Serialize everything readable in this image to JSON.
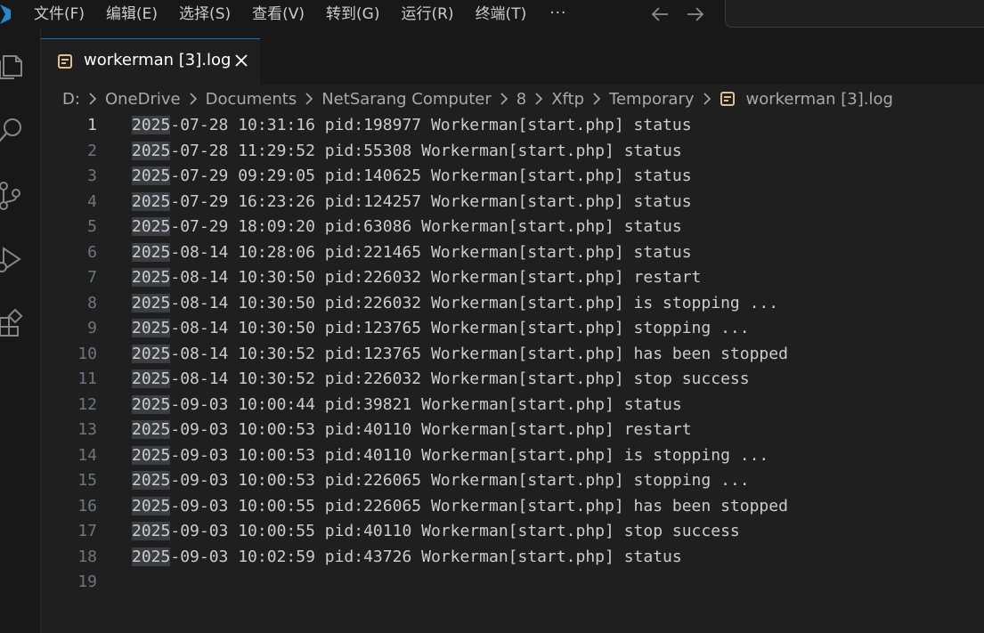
{
  "menubar": {
    "items": [
      "文件(F)",
      "编辑(E)",
      "选择(S)",
      "查看(V)",
      "转到(G)",
      "运行(R)",
      "终端(T)"
    ],
    "more": "···"
  },
  "tab": {
    "label": "workerman [3].log"
  },
  "breadcrumb": [
    "D:",
    "OneDrive",
    "Documents",
    "NetSarang Computer",
    "8",
    "Xftp",
    "Temporary",
    "workerman [3].log"
  ],
  "editor": {
    "highlight": "2025",
    "lines": [
      {
        "n": "1",
        "rest": "-07-28 10:31:16 pid:198977 Workerman[start.php] status"
      },
      {
        "n": "2",
        "rest": "-07-28 11:29:52 pid:55308 Workerman[start.php] status"
      },
      {
        "n": "3",
        "rest": "-07-29 09:29:05 pid:140625 Workerman[start.php] status"
      },
      {
        "n": "4",
        "rest": "-07-29 16:23:26 pid:124257 Workerman[start.php] status"
      },
      {
        "n": "5",
        "rest": "-07-29 18:09:20 pid:63086 Workerman[start.php] status"
      },
      {
        "n": "6",
        "rest": "-08-14 10:28:06 pid:221465 Workerman[start.php] status"
      },
      {
        "n": "7",
        "rest": "-08-14 10:30:50 pid:226032 Workerman[start.php] restart"
      },
      {
        "n": "8",
        "rest": "-08-14 10:30:50 pid:226032 Workerman[start.php] is stopping ..."
      },
      {
        "n": "9",
        "rest": "-08-14 10:30:50 pid:123765 Workerman[start.php] stopping ..."
      },
      {
        "n": "10",
        "rest": "-08-14 10:30:52 pid:123765 Workerman[start.php] has been stopped"
      },
      {
        "n": "11",
        "rest": "-08-14 10:30:52 pid:226032 Workerman[start.php] stop success"
      },
      {
        "n": "12",
        "rest": "-09-03 10:00:44 pid:39821 Workerman[start.php] status"
      },
      {
        "n": "13",
        "rest": "-09-03 10:00:53 pid:40110 Workerman[start.php] restart"
      },
      {
        "n": "14",
        "rest": "-09-03 10:00:53 pid:40110 Workerman[start.php] is stopping ..."
      },
      {
        "n": "15",
        "rest": "-09-03 10:00:53 pid:226065 Workerman[start.php] stopping ..."
      },
      {
        "n": "16",
        "rest": "-09-03 10:00:55 pid:226065 Workerman[start.php] has been stopped"
      },
      {
        "n": "17",
        "rest": "-09-03 10:00:55 pid:40110 Workerman[start.php] stop success"
      },
      {
        "n": "18",
        "rest": "-09-03 10:02:59 pid:43726 Workerman[start.php] status"
      },
      {
        "n": "19",
        "rest": ""
      }
    ]
  }
}
